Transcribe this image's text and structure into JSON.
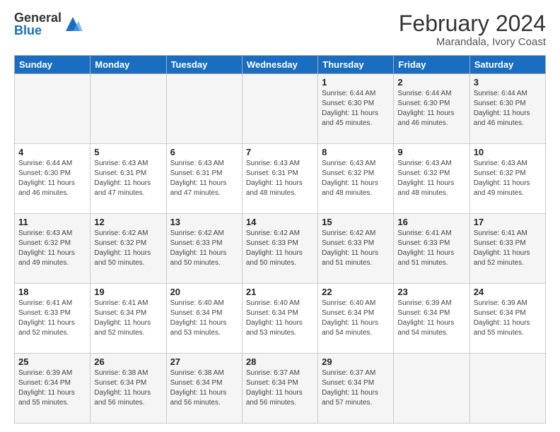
{
  "header": {
    "logo_general": "General",
    "logo_blue": "Blue",
    "main_title": "February 2024",
    "subtitle": "Marandala, Ivory Coast"
  },
  "days_of_week": [
    "Sunday",
    "Monday",
    "Tuesday",
    "Wednesday",
    "Thursday",
    "Friday",
    "Saturday"
  ],
  "weeks": [
    [
      {
        "day": "",
        "info": ""
      },
      {
        "day": "",
        "info": ""
      },
      {
        "day": "",
        "info": ""
      },
      {
        "day": "",
        "info": ""
      },
      {
        "day": "1",
        "info": "Sunrise: 6:44 AM\nSunset: 6:30 PM\nDaylight: 11 hours and 45 minutes."
      },
      {
        "day": "2",
        "info": "Sunrise: 6:44 AM\nSunset: 6:30 PM\nDaylight: 11 hours and 46 minutes."
      },
      {
        "day": "3",
        "info": "Sunrise: 6:44 AM\nSunset: 6:30 PM\nDaylight: 11 hours and 46 minutes."
      }
    ],
    [
      {
        "day": "4",
        "info": "Sunrise: 6:44 AM\nSunset: 6:30 PM\nDaylight: 11 hours and 46 minutes."
      },
      {
        "day": "5",
        "info": "Sunrise: 6:43 AM\nSunset: 6:31 PM\nDaylight: 11 hours and 47 minutes."
      },
      {
        "day": "6",
        "info": "Sunrise: 6:43 AM\nSunset: 6:31 PM\nDaylight: 11 hours and 47 minutes."
      },
      {
        "day": "7",
        "info": "Sunrise: 6:43 AM\nSunset: 6:31 PM\nDaylight: 11 hours and 48 minutes."
      },
      {
        "day": "8",
        "info": "Sunrise: 6:43 AM\nSunset: 6:32 PM\nDaylight: 11 hours and 48 minutes."
      },
      {
        "day": "9",
        "info": "Sunrise: 6:43 AM\nSunset: 6:32 PM\nDaylight: 11 hours and 48 minutes."
      },
      {
        "day": "10",
        "info": "Sunrise: 6:43 AM\nSunset: 6:32 PM\nDaylight: 11 hours and 49 minutes."
      }
    ],
    [
      {
        "day": "11",
        "info": "Sunrise: 6:43 AM\nSunset: 6:32 PM\nDaylight: 11 hours and 49 minutes."
      },
      {
        "day": "12",
        "info": "Sunrise: 6:42 AM\nSunset: 6:32 PM\nDaylight: 11 hours and 50 minutes."
      },
      {
        "day": "13",
        "info": "Sunrise: 6:42 AM\nSunset: 6:33 PM\nDaylight: 11 hours and 50 minutes."
      },
      {
        "day": "14",
        "info": "Sunrise: 6:42 AM\nSunset: 6:33 PM\nDaylight: 11 hours and 50 minutes."
      },
      {
        "day": "15",
        "info": "Sunrise: 6:42 AM\nSunset: 6:33 PM\nDaylight: 11 hours and 51 minutes."
      },
      {
        "day": "16",
        "info": "Sunrise: 6:41 AM\nSunset: 6:33 PM\nDaylight: 11 hours and 51 minutes."
      },
      {
        "day": "17",
        "info": "Sunrise: 6:41 AM\nSunset: 6:33 PM\nDaylight: 11 hours and 52 minutes."
      }
    ],
    [
      {
        "day": "18",
        "info": "Sunrise: 6:41 AM\nSunset: 6:33 PM\nDaylight: 11 hours and 52 minutes."
      },
      {
        "day": "19",
        "info": "Sunrise: 6:41 AM\nSunset: 6:34 PM\nDaylight: 11 hours and 52 minutes."
      },
      {
        "day": "20",
        "info": "Sunrise: 6:40 AM\nSunset: 6:34 PM\nDaylight: 11 hours and 53 minutes."
      },
      {
        "day": "21",
        "info": "Sunrise: 6:40 AM\nSunset: 6:34 PM\nDaylight: 11 hours and 53 minutes."
      },
      {
        "day": "22",
        "info": "Sunrise: 6:40 AM\nSunset: 6:34 PM\nDaylight: 11 hours and 54 minutes."
      },
      {
        "day": "23",
        "info": "Sunrise: 6:39 AM\nSunset: 6:34 PM\nDaylight: 11 hours and 54 minutes."
      },
      {
        "day": "24",
        "info": "Sunrise: 6:39 AM\nSunset: 6:34 PM\nDaylight: 11 hours and 55 minutes."
      }
    ],
    [
      {
        "day": "25",
        "info": "Sunrise: 6:39 AM\nSunset: 6:34 PM\nDaylight: 11 hours and 55 minutes."
      },
      {
        "day": "26",
        "info": "Sunrise: 6:38 AM\nSunset: 6:34 PM\nDaylight: 11 hours and 56 minutes."
      },
      {
        "day": "27",
        "info": "Sunrise: 6:38 AM\nSunset: 6:34 PM\nDaylight: 11 hours and 56 minutes."
      },
      {
        "day": "28",
        "info": "Sunrise: 6:37 AM\nSunset: 6:34 PM\nDaylight: 11 hours and 56 minutes."
      },
      {
        "day": "29",
        "info": "Sunrise: 6:37 AM\nSunset: 6:34 PM\nDaylight: 11 hours and 57 minutes."
      },
      {
        "day": "",
        "info": ""
      },
      {
        "day": "",
        "info": ""
      }
    ]
  ]
}
